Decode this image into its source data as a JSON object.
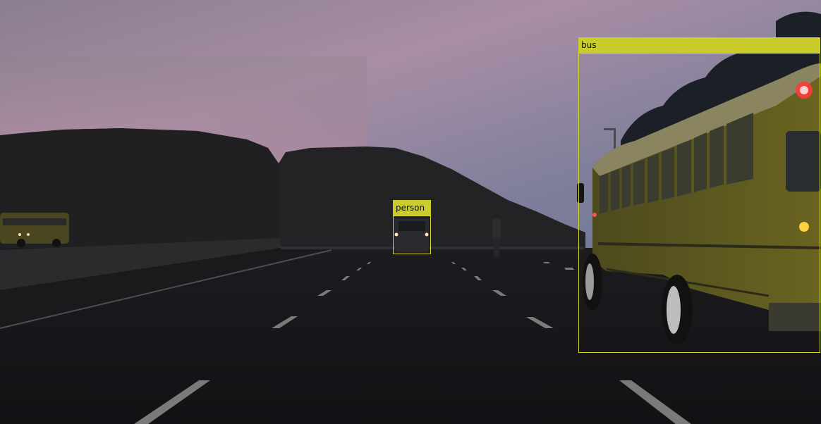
{
  "detections": [
    {
      "label": "bus",
      "color": "#c9cc2a"
    },
    {
      "label": "person",
      "color": "#c9cc2a"
    }
  ],
  "scene": {
    "sky_top_color": "#7e7f92",
    "sky_horizon_color": "#b08aa2",
    "road_color": "#16161a",
    "mountain_color": "#232326",
    "bus_body_color": "#5a5416"
  }
}
